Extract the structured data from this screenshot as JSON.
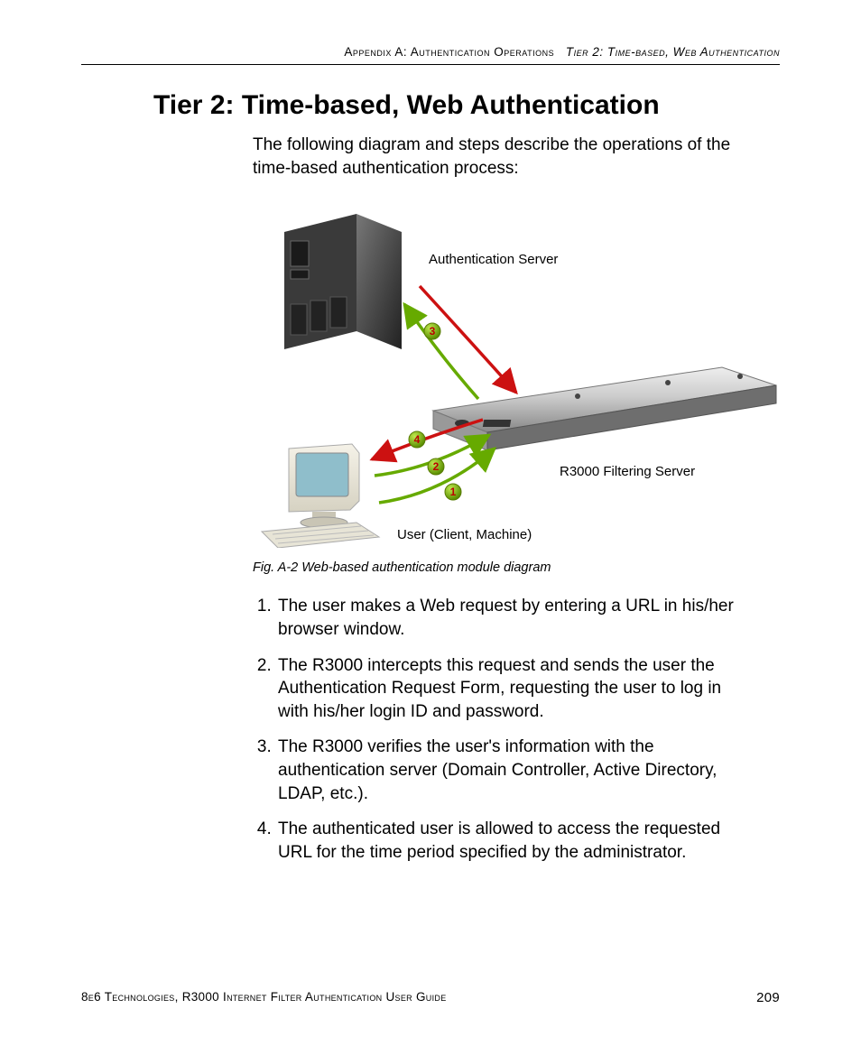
{
  "header": {
    "left": "Appendix A: Authentication Operations",
    "right": "Tier 2: Time-based, Web Authentication"
  },
  "title": "Tier 2: Time-based, Web Authentication",
  "intro": "The following diagram and steps describe the operations of the time-based authentication process:",
  "diagram": {
    "auth_server_label": "Authentication Server",
    "filter_server_label": "R3000 Filtering Server",
    "client_label": "User (Client, Machine)",
    "markers": {
      "m1": "1",
      "m2": "2",
      "m3": "3",
      "m4": "4"
    }
  },
  "caption": "Fig. A-2  Web-based authentication module diagram",
  "steps": [
    "The user makes a Web request by entering a URL in his/her browser window.",
    "The R3000 intercepts this request and sends the user the Authentication Request Form, requesting the user to log in with his/her login ID and password.",
    "The R3000 verifies the user's information with the authentication server (Domain Controller, Active Directory, LDAP, etc.).",
    "The authenticated user is allowed to access the requested URL for the time period specified by the administrator."
  ],
  "footer": {
    "text": "8e6 Technologies, R3000 Internet Filter Authentication User Guide",
    "page": "209"
  }
}
